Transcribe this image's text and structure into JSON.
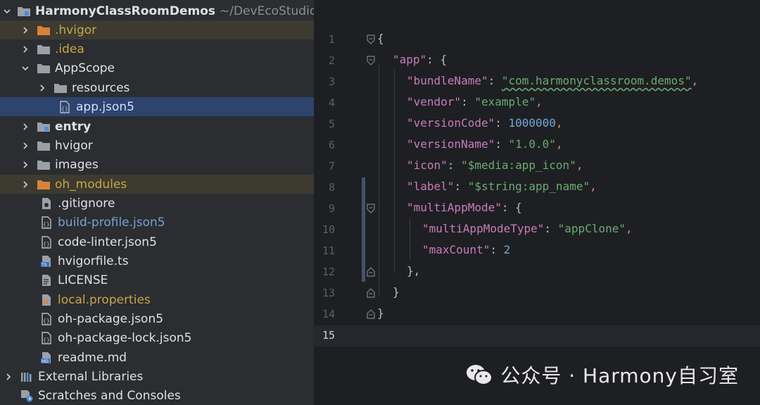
{
  "project_tree": {
    "root": {
      "name": "HarmonyClassRoomDemos",
      "path": "~/DevEcoStudioPro"
    },
    "items": [
      {
        "label": ".hvigor"
      },
      {
        "label": ".idea"
      },
      {
        "label": "AppScope"
      },
      {
        "label": "resources"
      },
      {
        "label": "app.json5"
      },
      {
        "label": "entry"
      },
      {
        "label": "hvigor"
      },
      {
        "label": "images"
      },
      {
        "label": "oh_modules"
      },
      {
        "label": ".gitignore"
      },
      {
        "label": "build-profile.json5"
      },
      {
        "label": "code-linter.json5"
      },
      {
        "label": "hvigorfile.ts"
      },
      {
        "label": "LICENSE"
      },
      {
        "label": "local.properties"
      },
      {
        "label": "oh-package.json5"
      },
      {
        "label": "oh-package-lock.json5"
      },
      {
        "label": "readme.md"
      },
      {
        "label": "External Libraries"
      },
      {
        "label": "Scratches and Consoles"
      }
    ]
  },
  "editor": {
    "line_numbers": [
      "1",
      "2",
      "3",
      "4",
      "5",
      "6",
      "7",
      "8",
      "9",
      "10",
      "11",
      "12",
      "13",
      "14",
      "15"
    ],
    "current_line": "15",
    "tokens": {
      "open_brace": "{",
      "close_brace": "}",
      "colon": ": ",
      "comma": ",",
      "app_key": "\"app\"",
      "bundleName_key": "\"bundleName\"",
      "bundleName_val": "\"com.harmonyclassroom.demos\"",
      "vendor_key": "\"vendor\"",
      "vendor_val": "\"example\"",
      "versionCode_key": "\"versionCode\"",
      "versionCode_val": "1000000",
      "versionName_key": "\"versionName\"",
      "versionName_val": "\"1.0.0\"",
      "icon_key": "\"icon\"",
      "icon_val": "\"$media:app_icon\"",
      "label_key": "\"label\"",
      "label_val": "\"$string:app_name\"",
      "multiAppMode_key": "\"multiAppMode\"",
      "multiAppModeType_key": "\"multiAppModeType\"",
      "multiAppModeType_val": "\"appClone\"",
      "maxCount_key": "\"maxCount\"",
      "maxCount_val": "2",
      "close_brace_comma": "},"
    }
  },
  "watermark": {
    "text": "公众号 · Harmony自习室"
  },
  "colors": {
    "tree_bg": "#2b2d30",
    "editor_bg": "#1e1f22",
    "selection": "#2e436e",
    "key": "#c77dbb",
    "string": "#6aab73",
    "number": "#6fa8dc"
  }
}
